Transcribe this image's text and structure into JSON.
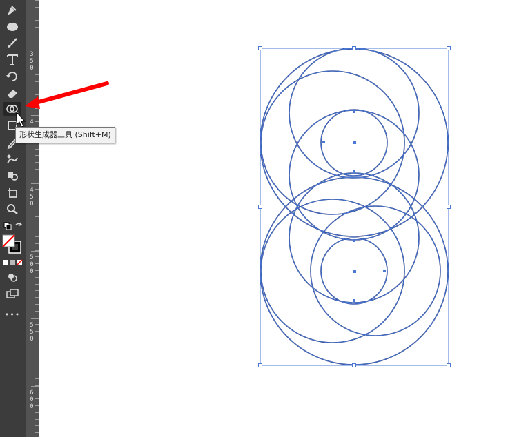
{
  "tooltip": {
    "text": "形状生成器工具 (Shift+M)",
    "target_tool": "shape-builder-tool"
  },
  "ruler": {
    "labels": [
      "3\n5\n0",
      "4",
      "4\n5\n0",
      "5\n0\n0",
      "5\n5\n0",
      "6\n0\n0"
    ]
  },
  "toolbar": {
    "tools": [
      "pen-tool-icon",
      "ellipse-tool-icon",
      "paintbrush-tool-icon",
      "type-tool-icon",
      "rotate-tool-icon",
      "eraser-tool-icon",
      "shape-builder-tool-icon",
      "free-transform-tool-icon",
      "eyedropper-tool-icon",
      "puppet-warp-tool-icon",
      "symbol-sprayer-tool-icon",
      "artboard-tool-icon",
      "zoom-tool-icon",
      "default-colors-icon",
      "swap-colors-icon",
      "fill-stroke-icon",
      "color-modes-icon",
      "drawing-modes-icon",
      "screen-mode-icon",
      "more-tools-icon"
    ],
    "more_label": "•••"
  },
  "colors": {
    "toolbar_bg": "#3c3c3c",
    "ruler_bg": "#535353",
    "selection_blue": "#4a78d4",
    "path_navy": "#1a2a6b",
    "arrow_red": "#ff0000"
  },
  "annotation": {
    "type": "arrow",
    "color": "#ff0000",
    "points_to": "shape-builder-tool"
  }
}
